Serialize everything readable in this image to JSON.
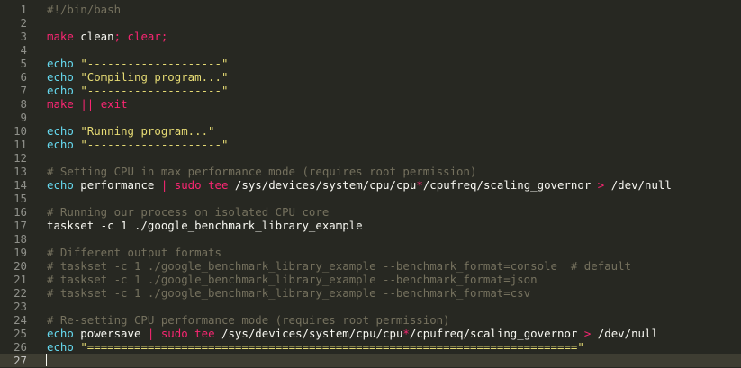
{
  "colors": {
    "background": "#272822",
    "current_line": "#3e3d32",
    "gutter_text": "#8f908a",
    "plain": "#f8f8f2",
    "comment": "#75715e",
    "keyword": "#f92672",
    "builtin": "#66d9ef",
    "string": "#e6db74"
  },
  "editor": {
    "current_line": 27,
    "lines": [
      {
        "n": "1",
        "tokens": [
          {
            "t": "#!/bin/bash",
            "c": "comment"
          }
        ]
      },
      {
        "n": "2",
        "tokens": []
      },
      {
        "n": "3",
        "tokens": [
          {
            "t": "make",
            "c": "keyword"
          },
          {
            "t": " clean",
            "c": "plain"
          },
          {
            "t": ";",
            "c": "keyword"
          },
          {
            "t": " clear",
            "c": "keyword"
          },
          {
            "t": ";",
            "c": "keyword"
          }
        ]
      },
      {
        "n": "4",
        "tokens": []
      },
      {
        "n": "5",
        "tokens": [
          {
            "t": "echo",
            "c": "builtin"
          },
          {
            "t": " ",
            "c": "plain"
          },
          {
            "t": "\"--------------------\"",
            "c": "string"
          }
        ]
      },
      {
        "n": "6",
        "tokens": [
          {
            "t": "echo",
            "c": "builtin"
          },
          {
            "t": " ",
            "c": "plain"
          },
          {
            "t": "\"Compiling program...\"",
            "c": "string"
          }
        ]
      },
      {
        "n": "7",
        "tokens": [
          {
            "t": "echo",
            "c": "builtin"
          },
          {
            "t": " ",
            "c": "plain"
          },
          {
            "t": "\"--------------------\"",
            "c": "string"
          }
        ]
      },
      {
        "n": "8",
        "tokens": [
          {
            "t": "make",
            "c": "keyword"
          },
          {
            "t": " ",
            "c": "plain"
          },
          {
            "t": "||",
            "c": "keyword"
          },
          {
            "t": " ",
            "c": "plain"
          },
          {
            "t": "exit",
            "c": "keyword"
          }
        ]
      },
      {
        "n": "9",
        "tokens": []
      },
      {
        "n": "10",
        "tokens": [
          {
            "t": "echo",
            "c": "builtin"
          },
          {
            "t": " ",
            "c": "plain"
          },
          {
            "t": "\"Running program...\"",
            "c": "string"
          }
        ]
      },
      {
        "n": "11",
        "tokens": [
          {
            "t": "echo",
            "c": "builtin"
          },
          {
            "t": " ",
            "c": "plain"
          },
          {
            "t": "\"--------------------\"",
            "c": "string"
          }
        ]
      },
      {
        "n": "12",
        "tokens": []
      },
      {
        "n": "13",
        "tokens": [
          {
            "t": "# Setting CPU in max performance mode (requires root permission)",
            "c": "comment"
          }
        ]
      },
      {
        "n": "14",
        "tokens": [
          {
            "t": "echo",
            "c": "builtin"
          },
          {
            "t": " performance ",
            "c": "plain"
          },
          {
            "t": "|",
            "c": "keyword"
          },
          {
            "t": " ",
            "c": "plain"
          },
          {
            "t": "sudo",
            "c": "keyword"
          },
          {
            "t": " ",
            "c": "plain"
          },
          {
            "t": "tee",
            "c": "keyword"
          },
          {
            "t": " /sys/devices/system/cpu/cpu",
            "c": "plain"
          },
          {
            "t": "*",
            "c": "keyword"
          },
          {
            "t": "/cpufreq/scaling_governor ",
            "c": "plain"
          },
          {
            "t": ">",
            "c": "keyword"
          },
          {
            "t": " /dev/null",
            "c": "plain"
          }
        ]
      },
      {
        "n": "15",
        "tokens": []
      },
      {
        "n": "16",
        "tokens": [
          {
            "t": "# Running our process on isolated CPU core",
            "c": "comment"
          }
        ]
      },
      {
        "n": "17",
        "tokens": [
          {
            "t": "taskset -c 1 ./google_benchmark_library_example",
            "c": "plain"
          }
        ]
      },
      {
        "n": "18",
        "tokens": []
      },
      {
        "n": "19",
        "tokens": [
          {
            "t": "# Different output formats",
            "c": "comment"
          }
        ]
      },
      {
        "n": "20",
        "tokens": [
          {
            "t": "# taskset -c 1 ./google_benchmark_library_example --benchmark_format=console  # default",
            "c": "comment"
          }
        ]
      },
      {
        "n": "21",
        "tokens": [
          {
            "t": "# taskset -c 1 ./google_benchmark_library_example --benchmark_format=json",
            "c": "comment"
          }
        ]
      },
      {
        "n": "22",
        "tokens": [
          {
            "t": "# taskset -c 1 ./google_benchmark_library_example --benchmark_format=csv",
            "c": "comment"
          }
        ]
      },
      {
        "n": "23",
        "tokens": []
      },
      {
        "n": "24",
        "tokens": [
          {
            "t": "# Re-setting CPU performance mode (requires root permission)",
            "c": "comment"
          }
        ]
      },
      {
        "n": "25",
        "tokens": [
          {
            "t": "echo",
            "c": "builtin"
          },
          {
            "t": " powersave ",
            "c": "plain"
          },
          {
            "t": "|",
            "c": "keyword"
          },
          {
            "t": " ",
            "c": "plain"
          },
          {
            "t": "sudo",
            "c": "keyword"
          },
          {
            "t": " ",
            "c": "plain"
          },
          {
            "t": "tee",
            "c": "keyword"
          },
          {
            "t": " /sys/devices/system/cpu/cpu",
            "c": "plain"
          },
          {
            "t": "*",
            "c": "keyword"
          },
          {
            "t": "/cpufreq/scaling_governor ",
            "c": "plain"
          },
          {
            "t": ">",
            "c": "keyword"
          },
          {
            "t": " /dev/null",
            "c": "plain"
          }
        ]
      },
      {
        "n": "26",
        "tokens": [
          {
            "t": "echo",
            "c": "builtin"
          },
          {
            "t": " ",
            "c": "plain"
          },
          {
            "t": "\"=========================================================================\"",
            "c": "string"
          }
        ]
      },
      {
        "n": "27",
        "tokens": []
      }
    ]
  }
}
